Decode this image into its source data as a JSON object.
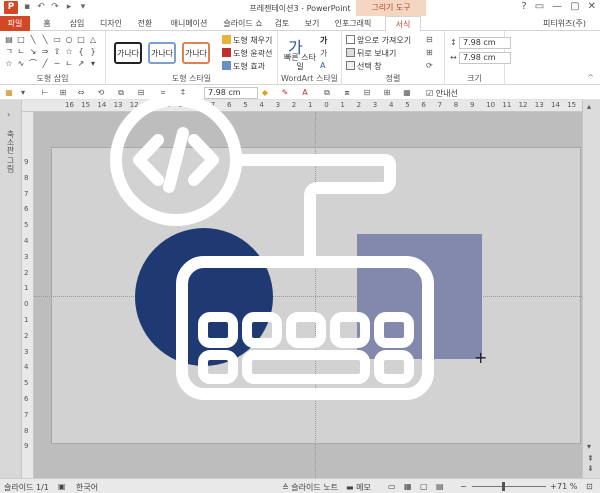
{
  "window": {
    "title": "프레젠테이션3 - PowerPoint",
    "contextual_tab": "그리기 도구",
    "app_icon": "P",
    "controls": [
      "?",
      "▭",
      "—",
      "▢",
      "✕"
    ]
  },
  "tabs": {
    "file": "파일",
    "items": [
      "홈",
      "삽입",
      "디자인",
      "전환",
      "애니메이션",
      "슬라이드 쇼",
      "검토",
      "보기",
      "인포그래픽"
    ],
    "format": "서식",
    "user": "피티위즈(주)"
  },
  "ribbon": {
    "insert_shapes_label": "도형 삽입",
    "shape_styles_label": "도형 스타일",
    "style_sample": "가나다",
    "fill_label": "도형 채우기",
    "outline_label": "도형 윤곽선",
    "effects_label": "도형 효과",
    "wordart_label": "WordArt 스타일",
    "quick_styles_label": "빠른 스타일",
    "arrange_label": "정렬",
    "bring_forward": "앞으로 가져오기",
    "send_backward": "뒤로 보내기",
    "selection_pane": "선택 창",
    "size_label": "크기",
    "height": "7.98 cm",
    "width": "7.98 cm"
  },
  "toolbar2": {
    "size_value": "7.98 cm",
    "gridlines_label": "안내선"
  },
  "rulers": {
    "h_ticks": [
      "16",
      "15",
      "14",
      "13",
      "12",
      "11",
      "10",
      "9",
      "8",
      "7",
      "6",
      "5",
      "4",
      "3",
      "2",
      "1",
      "0",
      "1",
      "2",
      "3",
      "4",
      "5",
      "6",
      "7",
      "8",
      "9",
      "10",
      "11",
      "12",
      "13",
      "14",
      "15",
      "16"
    ],
    "v_ticks": [
      "9",
      "8",
      "7",
      "6",
      "5",
      "4",
      "3",
      "2",
      "1",
      "0",
      "1",
      "2",
      "3",
      "4",
      "5",
      "6",
      "7",
      "8",
      "9"
    ]
  },
  "left_panel": {
    "label": "축소판 그림"
  },
  "status": {
    "slide": "슬라이드 1/1",
    "language": "한국어",
    "notes": "슬라이드 노트",
    "comments": "메모",
    "zoom": "71 %"
  },
  "colors": {
    "accent": "#d24726",
    "circle": "#1f3a73",
    "square": "#8289ac",
    "overlay_stroke": "#ffffff"
  },
  "icons": {
    "overlay_logo": "code-keyboard-icon",
    "crosshair": "crosshair-cursor-icon"
  }
}
